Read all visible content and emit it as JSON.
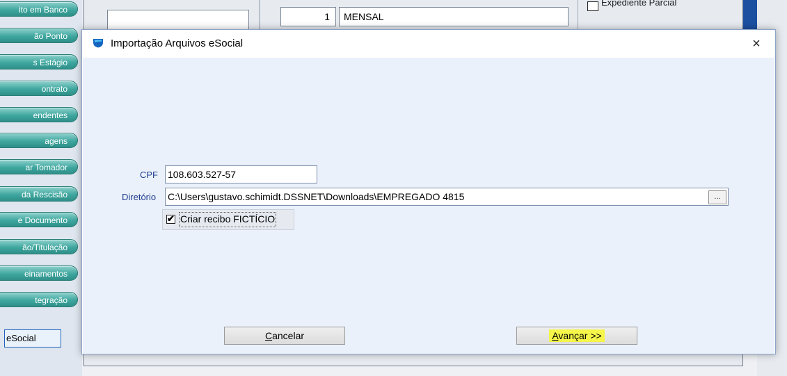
{
  "background": {
    "sidebar_items": [
      "ito em Banco",
      "ão Ponto",
      "s Estágio",
      "ontrato",
      "endentes",
      "agens",
      "ar Tomador",
      "da Rescisão",
      "e Documento",
      "ão/Titulação",
      "einamentos",
      "tegração"
    ],
    "sidebar_selected": "eSocial",
    "number_value": "1",
    "periodicity_value": "MENSAL",
    "checkbox_label": "Expediente Parcial"
  },
  "dialog": {
    "title": "Importação Arquivos eSocial",
    "close_glyph": "×",
    "cpf": {
      "label": "CPF",
      "value": "108.603.527-57"
    },
    "directory": {
      "label": "Diretório",
      "value": "C:\\Users\\gustavo.schimidt.DSSNET\\Downloads\\EMPREGADO 4815",
      "browse_label": "..."
    },
    "fake_receipt": {
      "label": "Criar recibo FICTÍCIO",
      "checked": true,
      "check_glyph": "✔"
    },
    "buttons": {
      "cancel_accel": "C",
      "cancel_rest": "ancelar",
      "next_accel": "A",
      "next_rest": "vançar >>"
    }
  },
  "colors": {
    "label_blue": "#1e3c8c",
    "client_bg": "#eaf1fb",
    "sidebar_teal": "#3fa79f",
    "highlight_yellow": "#f5f54a"
  },
  "icons": {
    "app": "shield-icon",
    "close": "close-icon"
  }
}
